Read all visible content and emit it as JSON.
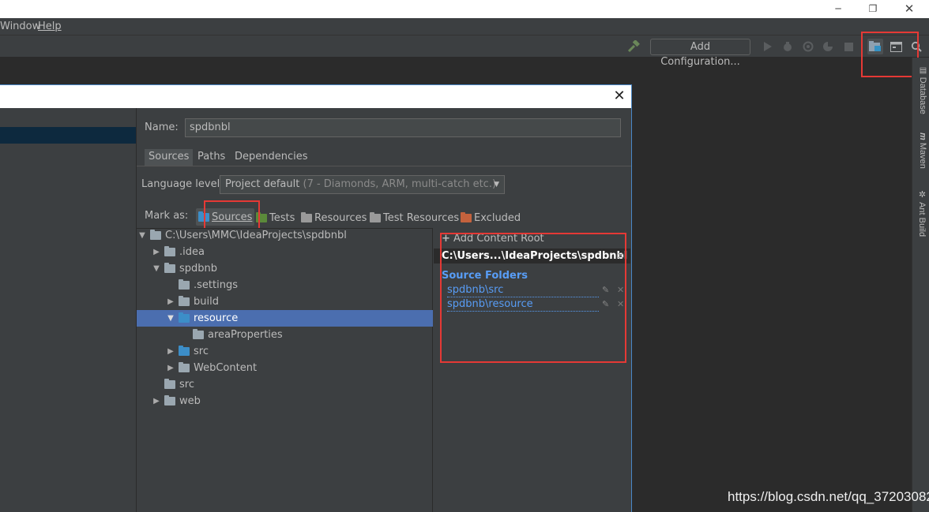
{
  "menu": {
    "window": "Window",
    "help": "Help"
  },
  "toolbar": {
    "add_configuration": "Add Configuration..."
  },
  "tool_windows": [
    "Database",
    "Maven",
    "Ant Build"
  ],
  "dialog": {
    "name_label": "Name:",
    "name_value": "spdbnbl",
    "tabs": [
      "Sources",
      "Paths",
      "Dependencies"
    ],
    "language_label": "Language level:",
    "language_value": "Project default",
    "language_detail": "(7 - Diamonds, ARM, multi-catch etc.)",
    "mark_as_label": "Mark as:",
    "mark_as": [
      {
        "label": "Sources",
        "color": "#3c8ec8"
      },
      {
        "label": "Tests",
        "color": "#5b8a3a"
      },
      {
        "label": "Resources",
        "color": "#9a9a9a"
      },
      {
        "label": "Test Resources",
        "color": "#9a9a9a"
      },
      {
        "label": "Excluded",
        "color": "#c4623d"
      }
    ],
    "tree": [
      {
        "label": "C:\\Users\\MMC\\IdeaProjects\\spdbnbl",
        "icon": "folder-icon"
      },
      {
        "label": ".idea",
        "icon": "folder-icon"
      },
      {
        "label": "spdbnb",
        "icon": "folder-icon"
      },
      {
        "label": ".settings",
        "icon": "folder-icon"
      },
      {
        "label": "build",
        "icon": "folder-icon"
      },
      {
        "label": "resource",
        "icon": "source-folder-icon"
      },
      {
        "label": "areaProperties",
        "icon": "package-folder-icon"
      },
      {
        "label": "src",
        "icon": "source-folder-icon"
      },
      {
        "label": "WebContent",
        "icon": "folder-icon"
      },
      {
        "label": "src",
        "icon": "folder-icon"
      },
      {
        "label": "web",
        "icon": "folder-icon"
      }
    ],
    "add_content_root": "Add Content Root",
    "root_path": "C:\\Users...\\IdeaProjects\\spdbnbl",
    "source_folders_title": "Source Folders",
    "source_folders": [
      "spdbnb\\src",
      "spdbnb\\resource"
    ]
  },
  "watermark": "https://blog.csdn.net/qq_37203082",
  "colors": {
    "accent": "#4b6eaf",
    "source_blue": "#589df6",
    "highlight_red": "#e53935"
  }
}
